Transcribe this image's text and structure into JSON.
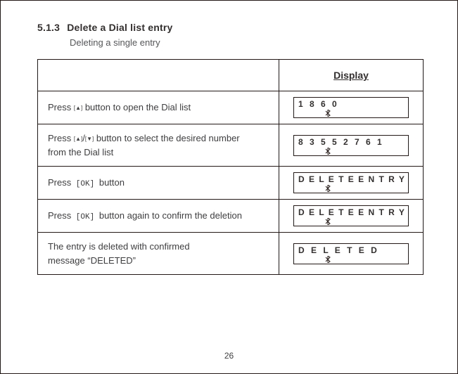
{
  "section": {
    "number": "5.1.3",
    "title": "Delete a Dial list entry",
    "subtitle": "Deleting a single entry"
  },
  "header": {
    "display": "Display"
  },
  "labels": {
    "press": "Press",
    "ok": " [OK] ",
    "up": "[▲]",
    "down": "[▼]"
  },
  "rows": {
    "r1": {
      "left_before": "Press ",
      "left_after": " button to open the Dial list",
      "display": "1 8 6 0"
    },
    "r2": {
      "line1_before": "Press ",
      "line1_mid": "/",
      "line1_after": " button to select the desired number",
      "line2": "from the Dial list",
      "display": "8 3 5 5 2 7 6 1"
    },
    "r3": {
      "left_after": " button",
      "display": "D E L E T E   E N T R Y"
    },
    "r4": {
      "left_after": " button again to confirm the deletion",
      "display": "D E L E T E   E N T R Y"
    },
    "r5": {
      "line1": "The entry is deleted  with confirmed",
      "line2": "message “DELETED”",
      "display": "D E L E T E D"
    }
  },
  "page_number": "26"
}
